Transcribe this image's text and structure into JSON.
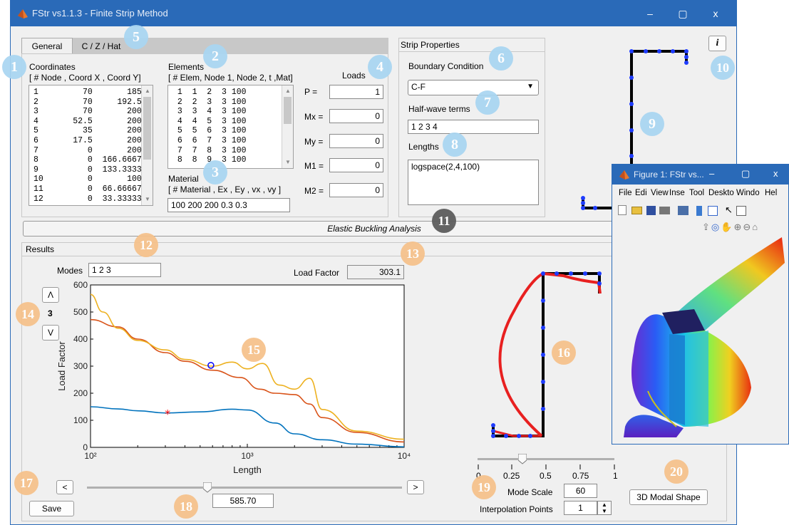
{
  "window": {
    "title": "FStr vs1.1.3  -  Finite Strip Method",
    "minimize": "–",
    "maximize": "▢",
    "close": "x"
  },
  "tabs": [
    {
      "label": "General"
    },
    {
      "label": "C / Z / Hat"
    }
  ],
  "coordinates": {
    "title": "Coordinates",
    "header": "[ # Node , Coord X ,  Coord Y]",
    "rows": [
      [
        "1",
        "70",
        "185"
      ],
      [
        "2",
        "70",
        "192.5"
      ],
      [
        "3",
        "70",
        "200"
      ],
      [
        "4",
        "52.5",
        "200"
      ],
      [
        "5",
        "35",
        "200"
      ],
      [
        "6",
        "17.5",
        "200"
      ],
      [
        "7",
        "0",
        "200"
      ],
      [
        "8",
        "0",
        "166.6667"
      ],
      [
        "9",
        "0",
        "133.3333"
      ],
      [
        "10",
        "0",
        "100"
      ],
      [
        "11",
        "0",
        "66.66667"
      ],
      [
        "12",
        "0",
        "33.33333"
      ]
    ]
  },
  "elements": {
    "title": "Elements",
    "header": "[ # Elem, Node 1, Node 2, t ,Mat]",
    "rows": [
      [
        "1",
        "1",
        "2",
        "3",
        "100"
      ],
      [
        "2",
        "2",
        "3",
        "3",
        "100"
      ],
      [
        "3",
        "3",
        "4",
        "3",
        "100"
      ],
      [
        "4",
        "4",
        "5",
        "3",
        "100"
      ],
      [
        "5",
        "5",
        "6",
        "3",
        "100"
      ],
      [
        "6",
        "6",
        "7",
        "3",
        "100"
      ],
      [
        "7",
        "7",
        "8",
        "3",
        "100"
      ],
      [
        "8",
        "8",
        "9",
        "3",
        "100"
      ]
    ]
  },
  "material": {
    "title": "Material",
    "header": "[ # Material , Ex , Ey , vx , vy ]",
    "value": "100  200  200  0.3  0.3"
  },
  "loads": {
    "title": "Loads",
    "items": [
      {
        "label": "P =",
        "value": "1"
      },
      {
        "label": "Mx =",
        "value": "0"
      },
      {
        "label": "My =",
        "value": "0"
      },
      {
        "label": "M1 =",
        "value": "0"
      },
      {
        "label": "M2 =",
        "value": "0"
      }
    ]
  },
  "strip": {
    "title": "Strip Properties",
    "bc_label": "Boundary Condition",
    "bc_value": "C-F",
    "hw_label": "Half-wave terms",
    "hw_value": "1 2 3 4",
    "len_label": "Lengths",
    "len_value": "logspace(2,4,100)"
  },
  "info_button": "i",
  "analysis_button": "Elastic Buckling Analysis",
  "results": {
    "title": "Results",
    "modes_label": "Modes",
    "modes_value": "1 2 3",
    "lf_label": "Load Factor",
    "lf_value": "303.1",
    "mode_up": "Λ",
    "mode_num": "3",
    "mode_down": "V",
    "prev": "<",
    "next": ">",
    "slider_value": "585.70",
    "save": "Save"
  },
  "mode_controls": {
    "scale_label": "Mode Scale",
    "scale_value": "60",
    "interp_label": "Interpolation Points",
    "interp_value": "1",
    "ticks": [
      "0",
      "0.25",
      "0.5",
      "0.75",
      "1"
    ],
    "btn3d": "3D Modal Shape"
  },
  "figure": {
    "title": "Figure 1: FStr vs...",
    "menu": [
      "File",
      "Edi",
      "View",
      "Inse",
      "Tool",
      "Deskto",
      "Windo",
      "Hel"
    ]
  },
  "bubbles": [
    "1",
    "2",
    "3",
    "4",
    "5",
    "6",
    "7",
    "8",
    "9",
    "10",
    "11",
    "12",
    "13",
    "14",
    "15",
    "16",
    "17",
    "18",
    "19",
    "20"
  ],
  "colors": {
    "blue_bubble": "#a9d6f2",
    "orange_bubble": "#f6c18a",
    "titlebar": "#2a6ab8",
    "mode_shape": "#e82020"
  },
  "chart_data": {
    "type": "line",
    "xscale": "log",
    "xlim": [
      100,
      10000
    ],
    "ylim": [
      0,
      600
    ],
    "xlabel": "Length",
    "ylabel": "Load Factor",
    "xticks": [
      "10²",
      "10³",
      "10⁴"
    ],
    "yticks": [
      "0",
      "100",
      "200",
      "300",
      "400",
      "500",
      "600"
    ],
    "series": [
      {
        "color": "#0072bd",
        "x": [
          100,
          150,
          200,
          300,
          500,
          800,
          1000,
          1500,
          2000,
          3000,
          5000,
          10000
        ],
        "y": [
          150,
          142,
          135,
          127,
          131,
          141,
          138,
          90,
          50,
          28,
          12,
          2
        ]
      },
      {
        "color": "#d95319",
        "x": [
          100,
          150,
          200,
          300,
          400,
          600,
          900,
          1200,
          1500,
          2000,
          2500,
          3000,
          5000,
          10000
        ],
        "y": [
          472,
          445,
          400,
          350,
          318,
          285,
          258,
          215,
          200,
          195,
          160,
          110,
          55,
          20
        ]
      },
      {
        "color": "#edb120",
        "x": [
          100,
          120,
          150,
          200,
          300,
          400,
          600,
          800,
          1000,
          1250,
          1600,
          2000,
          2500,
          3000,
          5000,
          10000
        ],
        "y": [
          565,
          500,
          440,
          395,
          360,
          325,
          300,
          315,
          290,
          310,
          230,
          215,
          255,
          140,
          60,
          30
        ]
      }
    ],
    "markers": [
      {
        "type": "star",
        "x": 310,
        "y": 125,
        "color": "#ff0000"
      },
      {
        "type": "circle",
        "x": 585.7,
        "y": 303,
        "color": "#0000ff"
      }
    ]
  }
}
